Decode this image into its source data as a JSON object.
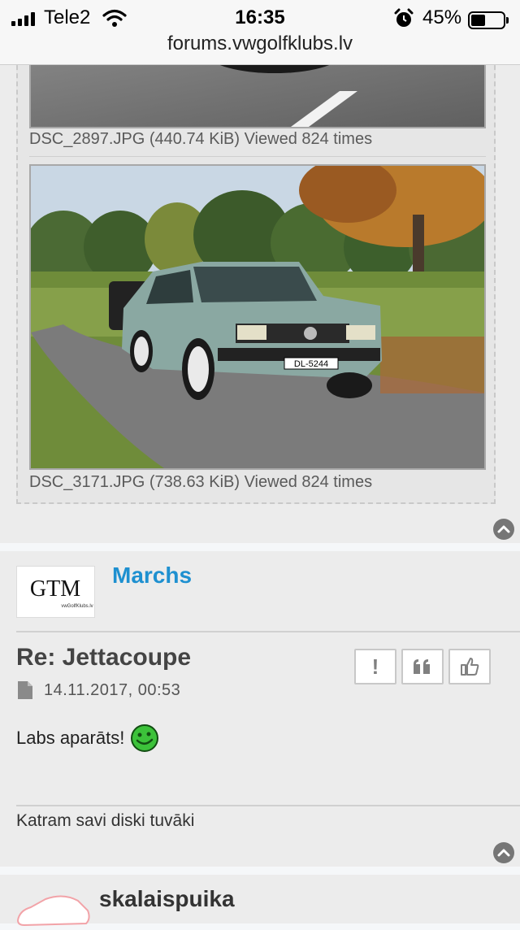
{
  "status_bar": {
    "carrier": "Tele2",
    "time": "16:35",
    "battery_percent_label": "45%",
    "battery_level": 0.45,
    "url": "forums.vwgolfklubs.lv"
  },
  "attachments": [
    {
      "caption": "DSC_2897.JPG (440.74 KiB) Viewed 824 times"
    },
    {
      "caption": "DSC_3171.JPG (738.63 KiB) Viewed 824 times",
      "plate": "DL-5244"
    }
  ],
  "post": {
    "username": "Marchs",
    "avatar_text": "GTM",
    "avatar_subtext": "vwGolfKlubs.lv",
    "title": "Re: Jettacoupe",
    "date": "14.11.2017, 00:53",
    "body": "Labs aparāts!",
    "signature": "Katram savi diski tuvāki",
    "actions": {
      "report": "!",
      "quote": "❝",
      "like": "👍"
    }
  },
  "next_post": {
    "username": "skalaispuika"
  },
  "icons": {
    "signal": "signal-icon",
    "wifi": "wifi-icon",
    "alarm": "alarm-icon",
    "battery": "battery-icon",
    "back_to_top": "chevron-up-icon",
    "post": "document-icon",
    "smiley": "smiley-icon"
  }
}
